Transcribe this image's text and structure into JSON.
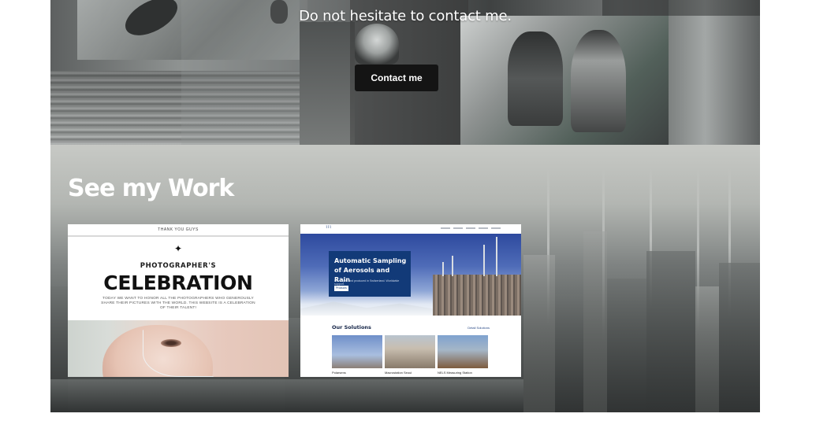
{
  "contact": {
    "text": "Do not hesitate to contact me.",
    "button_label": "Contact me"
  },
  "work": {
    "title": "See my Work",
    "cards": [
      {
        "topbar": "THANK YOU GUYS",
        "kicker": "PHOTOGRAPHER'S",
        "headline": "CELEBRATION",
        "subtitle": "TODAY WE WANT TO HONOR ALL THE PHOTOGRAPHERS WHO GENEROUSLY SHARE THEIR PICTURES WITH THE WORLD. THIS WEBSITE IS A CELEBRATION OF THEIR TALENT!"
      },
      {
        "hero_heading": "Automatic Sampling of Aerosols and Rain",
        "hero_description": "Developed and produced in Switzerland. Worldwide support.",
        "hero_button": "Products",
        "section_title": "Our Solutions",
        "more_link": "Detail Solutions",
        "solutions": [
          "Polarsens",
          "Macrostation Seoul",
          "NELS Measuring Station"
        ]
      }
    ]
  },
  "colors": {
    "button_bg": "#141414",
    "title_text": "#ffffff",
    "page_bg": "#ffffff"
  }
}
